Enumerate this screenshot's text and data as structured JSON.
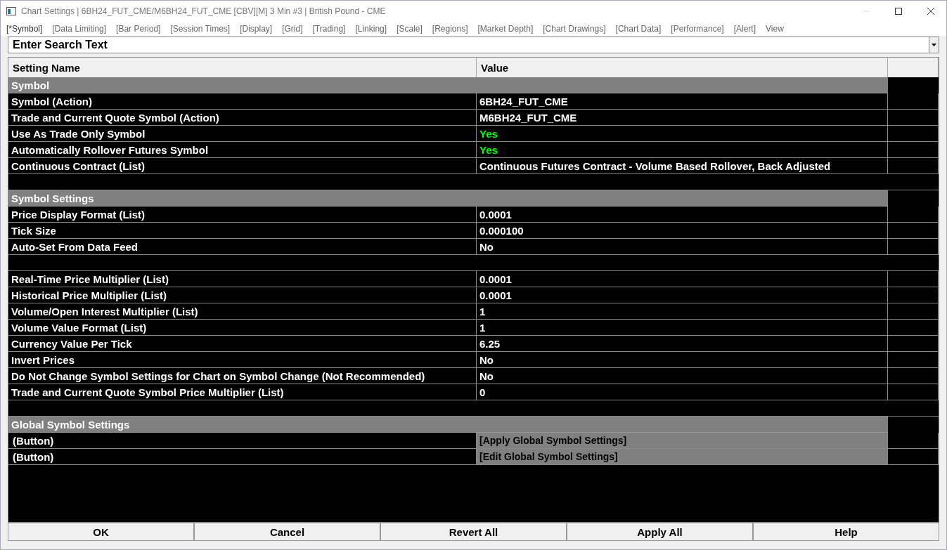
{
  "window": {
    "title": "Chart Settings | 6BH24_FUT_CME/M6BH24_FUT_CME [CBV][M]  3 Min  #3 | British Pound - CME"
  },
  "menu": [
    {
      "label": "[*Symbol]",
      "selected": true
    },
    {
      "label": "[Data Limiting]",
      "selected": false
    },
    {
      "label": "[Bar Period]",
      "selected": false
    },
    {
      "label": "[Session Times]",
      "selected": false
    },
    {
      "label": "[Display]",
      "selected": false
    },
    {
      "label": "[Grid]",
      "selected": false
    },
    {
      "label": "[Trading]",
      "selected": false
    },
    {
      "label": "[Linking]",
      "selected": false
    },
    {
      "label": "[Scale]",
      "selected": false
    },
    {
      "label": "[Regions]",
      "selected": false
    },
    {
      "label": "[Market Depth]",
      "selected": false
    },
    {
      "label": "[Chart Drawings]",
      "selected": false
    },
    {
      "label": "[Chart Data]",
      "selected": false
    },
    {
      "label": "[Performance]",
      "selected": false
    },
    {
      "label": "[Alert]",
      "selected": false
    },
    {
      "label": "View",
      "selected": false
    }
  ],
  "search": {
    "placeholder": "Enter Search Text"
  },
  "table": {
    "columns": [
      "Setting Name",
      "Value"
    ],
    "rows": [
      {
        "kind": "section",
        "name": "Symbol"
      },
      {
        "kind": "setting",
        "name": "Symbol (Action)",
        "value": "6BH24_FUT_CME"
      },
      {
        "kind": "setting",
        "name": "Trade and Current Quote Symbol (Action)",
        "value": "M6BH24_FUT_CME"
      },
      {
        "kind": "setting",
        "name": "Use As Trade Only Symbol",
        "value": "Yes",
        "color": "#00ff00"
      },
      {
        "kind": "setting",
        "name": "Automatically Rollover Futures Symbol",
        "value": "Yes",
        "color": "#00ff00"
      },
      {
        "kind": "setting",
        "name": "Continuous Contract (List)",
        "value": "Continuous Futures Contract - Volume Based Rollover, Back Adjusted"
      },
      {
        "kind": "spacer"
      },
      {
        "kind": "section",
        "name": "Symbol Settings"
      },
      {
        "kind": "setting",
        "name": "Price Display Format (List)",
        "value": "0.0001"
      },
      {
        "kind": "setting",
        "name": "Tick Size",
        "value": "0.000100"
      },
      {
        "kind": "setting",
        "name": "Auto-Set From Data Feed",
        "value": "No"
      },
      {
        "kind": "spacer"
      },
      {
        "kind": "setting",
        "name": "Real-Time Price Multiplier (List)",
        "value": "0.0001"
      },
      {
        "kind": "setting",
        "name": "Historical Price Multiplier (List)",
        "value": "0.0001"
      },
      {
        "kind": "setting",
        "name": "Volume/Open Interest Multiplier (List)",
        "value": "1"
      },
      {
        "kind": "setting",
        "name": "Volume Value Format (List)",
        "value": "1"
      },
      {
        "kind": "setting",
        "name": "Currency Value Per Tick",
        "value": "6.25"
      },
      {
        "kind": "setting",
        "name": "Invert Prices",
        "value": "No"
      },
      {
        "kind": "setting",
        "name": "Do Not Change Symbol Settings for Chart on Symbol Change (Not Recommended)",
        "value": "No"
      },
      {
        "kind": "setting",
        "name": "Trade and Current Quote Symbol Price Multiplier (List)",
        "value": "0"
      },
      {
        "kind": "spacer"
      },
      {
        "kind": "section",
        "name": "Global Symbol Settings"
      },
      {
        "kind": "action",
        "name": "(Button)",
        "value": "[Apply Global Symbol Settings]"
      },
      {
        "kind": "action",
        "name": "(Button)",
        "value": "[Edit Global Symbol Settings]"
      }
    ]
  },
  "buttons": [
    "OK",
    "Cancel",
    "Revert All",
    "Apply All",
    "Help"
  ]
}
